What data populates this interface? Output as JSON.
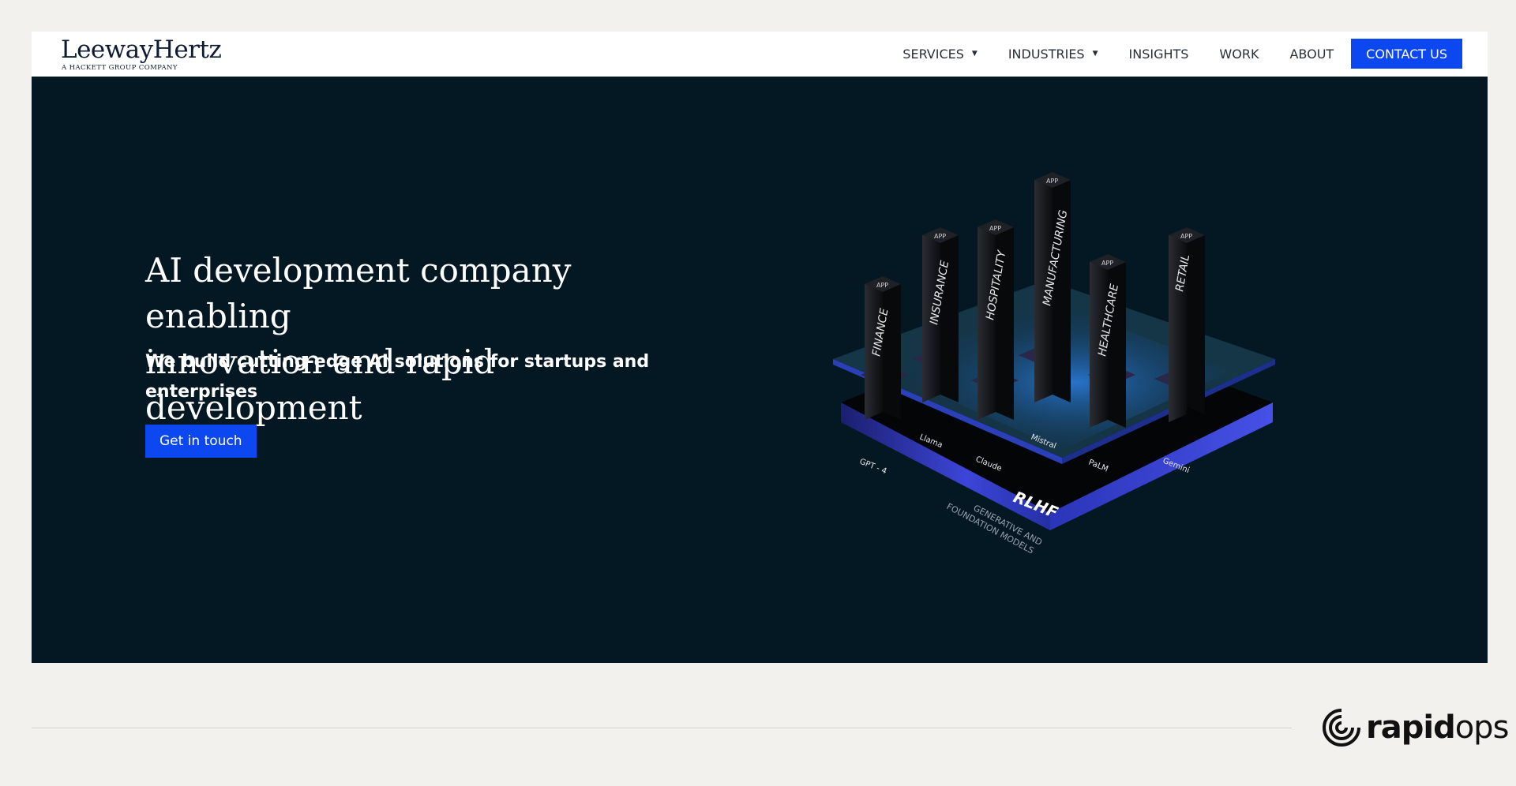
{
  "brand": {
    "name": "LeewayHertz",
    "tagline": "A HACKETT GROUP COMPANY"
  },
  "nav": {
    "items": [
      {
        "label": "SERVICES",
        "dropdown": true
      },
      {
        "label": "INDUSTRIES",
        "dropdown": true
      },
      {
        "label": "INSIGHTS"
      },
      {
        "label": "WORK"
      },
      {
        "label": "ABOUT"
      }
    ],
    "cta": "CONTACT US"
  },
  "hero": {
    "title_line1": "AI development company enabling",
    "title_line2": "innovation and rapid development",
    "subtitle": "We build cutting-edge AI solutions for startups and enterprises",
    "cta": "Get in touch"
  },
  "illustration": {
    "industries": [
      "FINANCE",
      "INSURANCE",
      "HOSPITALITY",
      "MANUFACTURING",
      "HEALTHCARE",
      "RETAIL"
    ],
    "app_label": "APP",
    "models": [
      "GPT - 4",
      "Llama",
      "Claude",
      "Mistral",
      "PaLM",
      "Gemini"
    ],
    "layer_label": "RLHF",
    "base_line1": "GENERATIVE AND",
    "base_line2": "FOUNDATION MODELS"
  },
  "footer": {
    "partner_bold": "rapid",
    "partner_light": "ops"
  },
  "colors": {
    "accent": "#0c47f0",
    "hero_bg": "#041823",
    "page_bg": "#f2f1ed",
    "text_dark": "#0c1b33"
  }
}
